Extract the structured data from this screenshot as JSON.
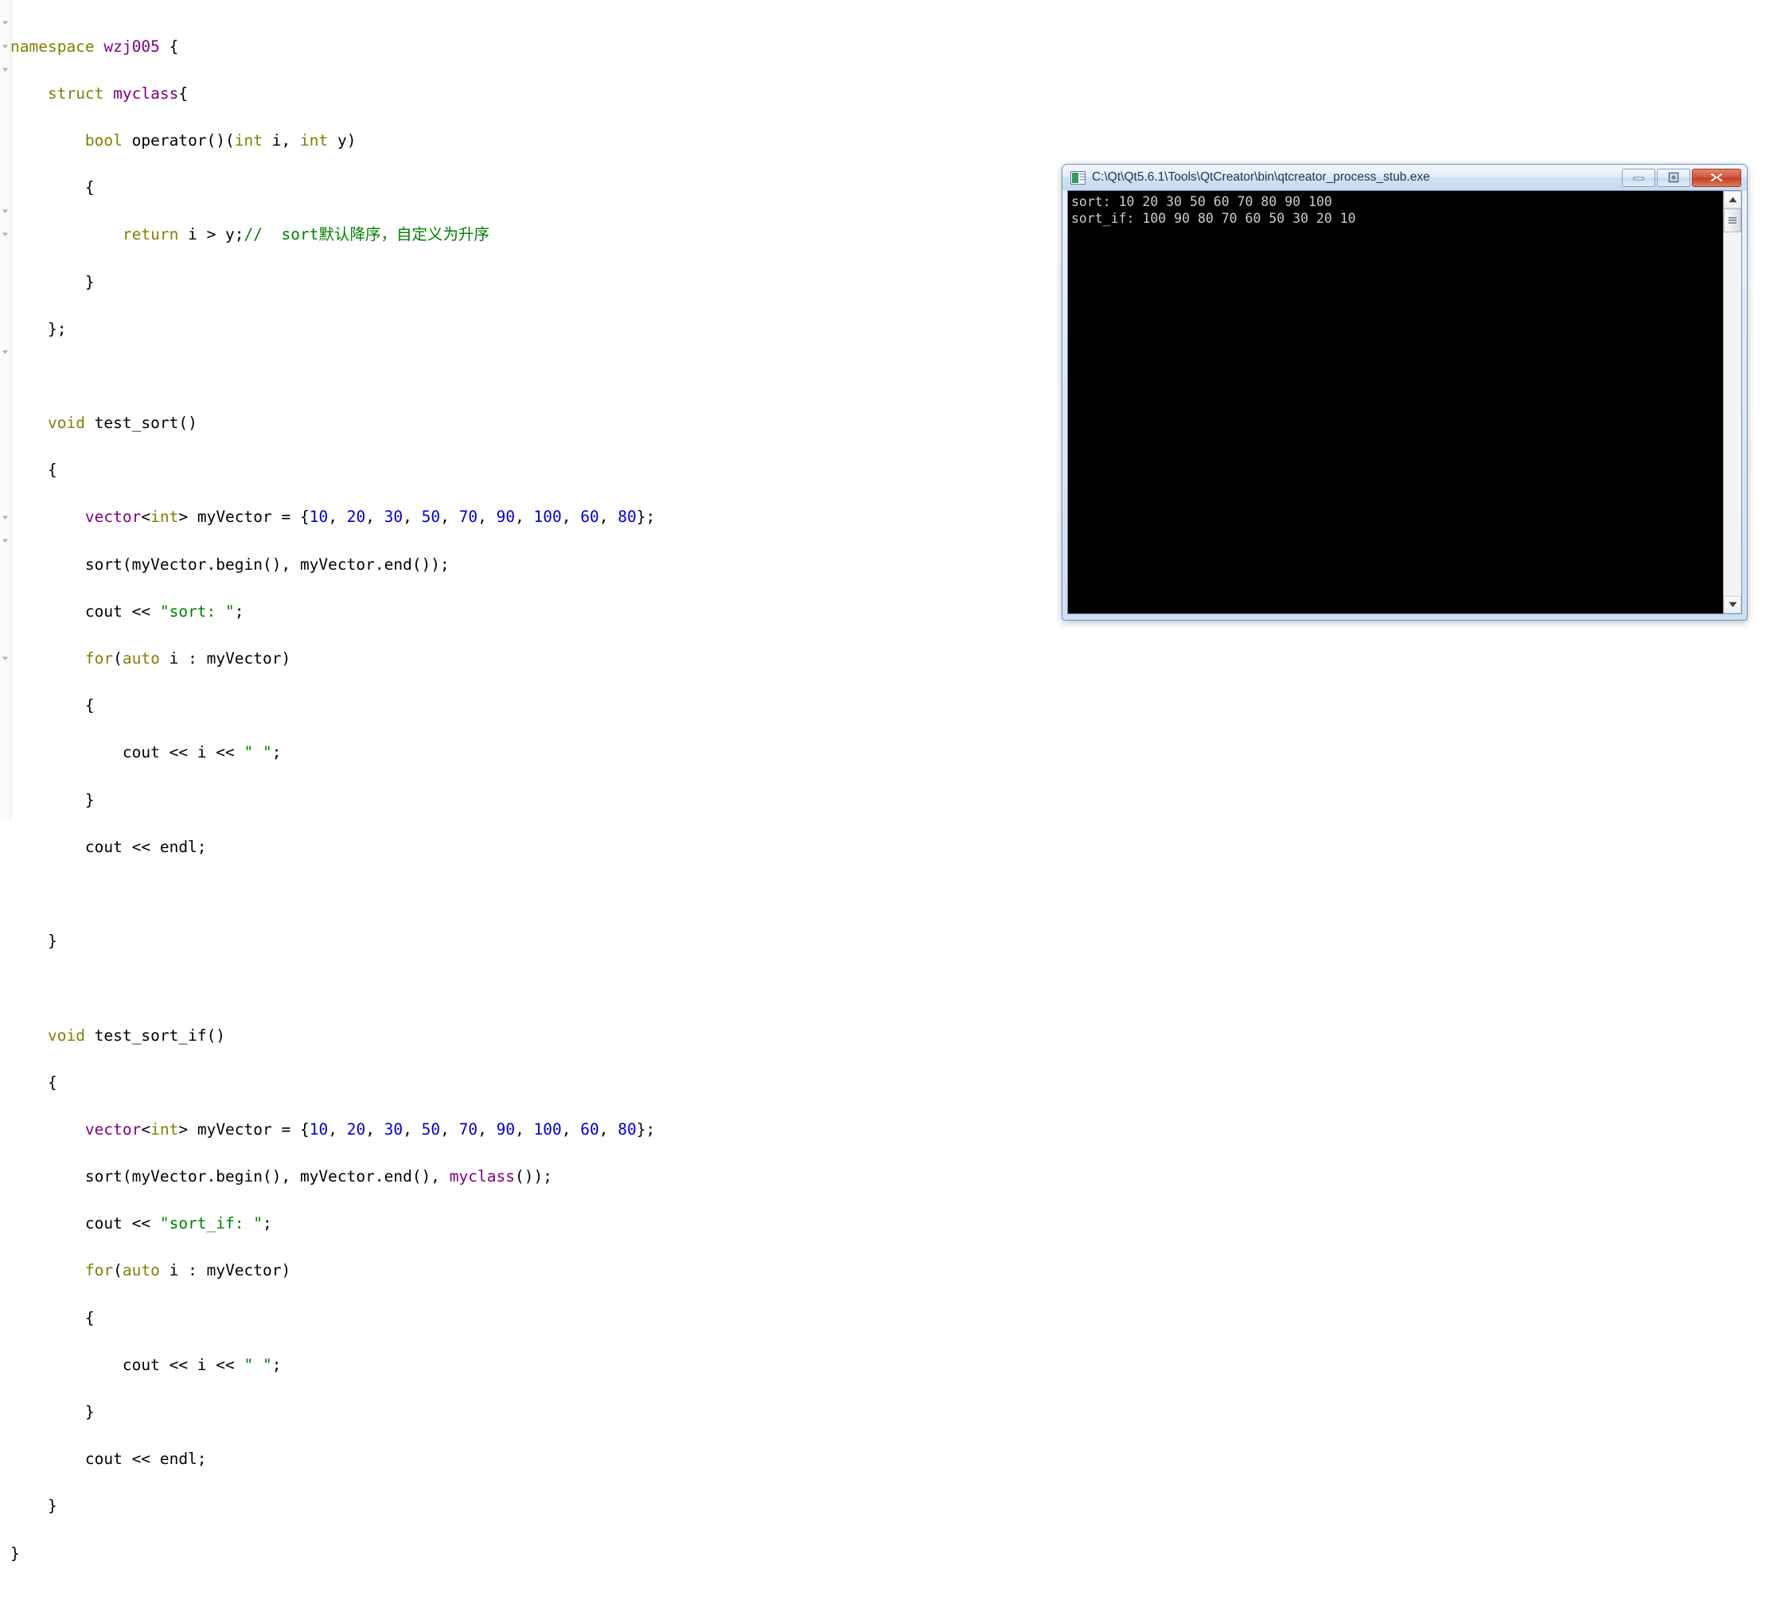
{
  "editor": {
    "name": "code-editor",
    "language": "C++",
    "background": "#ffffff",
    "colors": {
      "keyword": "#808000",
      "type": "#800080",
      "number": "#0000d0",
      "string": "#008000",
      "comment": "#008000",
      "plain": "#000000"
    },
    "lines": [
      "namespace wzj005 {",
      "    struct myclass{",
      "        bool operator()(int i, int y)",
      "        {",
      "            return i > y;//  sort默认降序，自定义为升序",
      "        }",
      "    };",
      "",
      "    void test_sort()",
      "    {",
      "        vector<int> myVector = {10, 20, 30, 50, 70, 90, 100, 60, 80};",
      "        sort(myVector.begin(), myVector.end());",
      "        cout << \"sort: \";",
      "        for(auto i : myVector)",
      "        {",
      "            cout << i << \" \";",
      "        }",
      "        cout << endl;",
      "",
      "    }",
      "",
      "    void test_sort_if()",
      "    {",
      "        vector<int> myVector = {10, 20, 30, 50, 70, 90, 100, 60, 80};",
      "        sort(myVector.begin(), myVector.end(), myclass());",
      "        cout << \"sort_if: \";",
      "        for(auto i : myVector)",
      "        {",
      "            cout << i << \" \";",
      "        }",
      "        cout << endl;",
      "    }",
      "}"
    ],
    "fold_marker_lines": [
      1,
      2,
      3,
      9,
      10,
      15,
      22,
      23,
      28
    ]
  },
  "console_window": {
    "title": "C:\\Qt\\Qt5.6.1\\Tools\\QtCreator\\bin\\qtcreator_process_stub.exe",
    "app_icon": "console-app-icon",
    "controls": {
      "minimize_label": "minimize",
      "maximize_label": "maximize",
      "close_label": "close"
    },
    "output": "sort: 10 20 30 50 60 70 80 90 100\nsort_if: 100 90 80 70 60 50 30 20 10",
    "output_lines": [
      "sort: 10 20 30 50 60 70 80 90 100",
      "sort_if: 100 90 80 70 60 50 30 20 10"
    ],
    "background": "#000000",
    "text_color": "#cccccc",
    "scrollbar": {
      "up_arrow": "scroll-up-icon",
      "down_arrow": "scroll-down-icon",
      "thumb_position": "top"
    }
  }
}
